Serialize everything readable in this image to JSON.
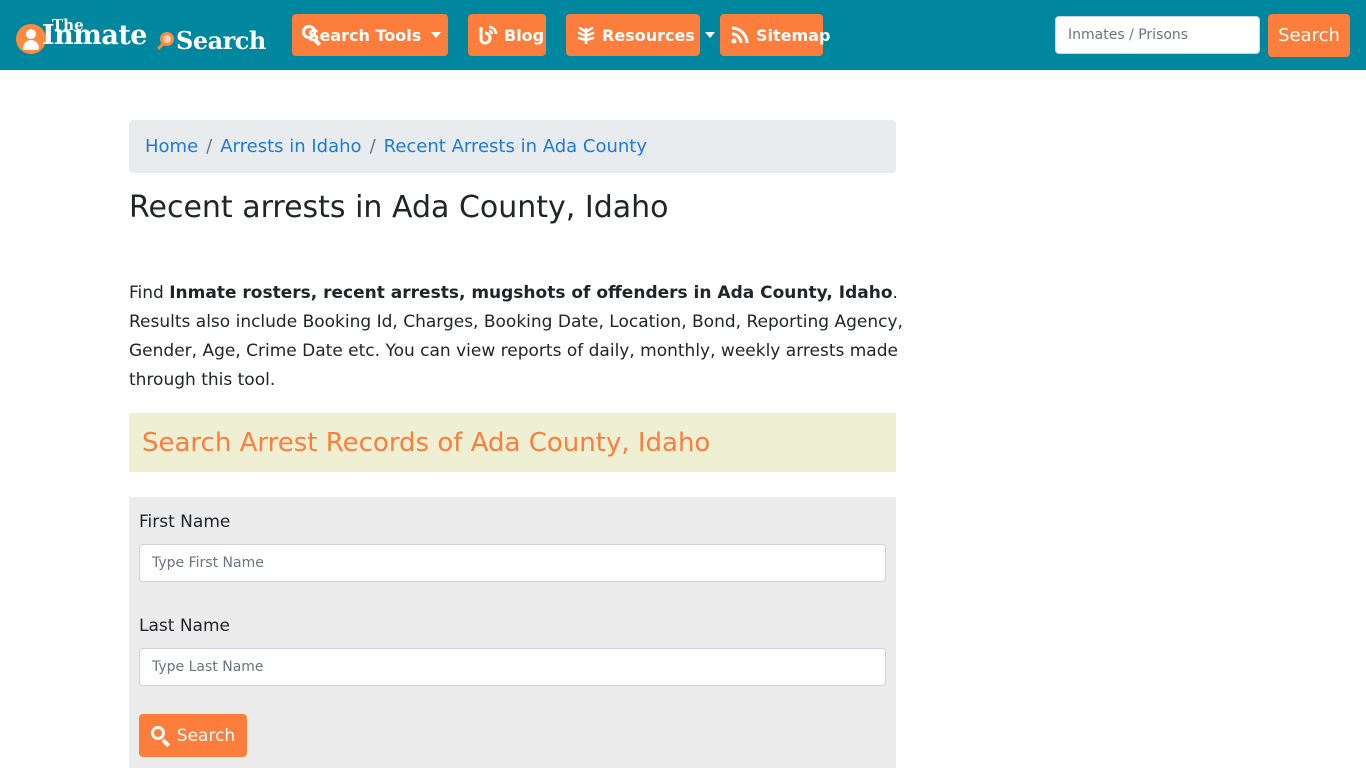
{
  "header": {
    "logo": {
      "the": "The",
      "inmate": "Inmate",
      "search": "Search"
    },
    "nav": [
      {
        "label": "Search Tools",
        "icon": "search-icon",
        "dropdown": true
      },
      {
        "label": "Blog",
        "icon": "blog-icon",
        "dropdown": false
      },
      {
        "label": "Resources",
        "icon": "leaf-icon",
        "dropdown": true
      },
      {
        "label": "Sitemap",
        "icon": "rss-icon",
        "dropdown": false
      }
    ],
    "search": {
      "placeholder": "Inmates / Prisons",
      "value": "",
      "button_label": "Search"
    }
  },
  "breadcrumb": [
    {
      "label": "Home"
    },
    {
      "label": "Arrests in Idaho"
    },
    {
      "label": "Recent Arrests in Ada County"
    }
  ],
  "main": {
    "title": "Recent arrests in Ada County, Idaho",
    "intro": {
      "prefix": "Find ",
      "bold": "Inmate rosters, recent arrests, mugshots of offenders in Ada County, Idaho",
      "suffix": ". Results also include Booking Id, Charges, Booking Date, Location, Bond, Reporting Agency, Gender, Age, Crime Date etc. You can view reports of daily, monthly, weekly arrests made through this tool."
    },
    "section_title": "Search Arrest Records of Ada County, Idaho",
    "form": {
      "first_name_label": "First Name",
      "first_name_placeholder": "Type First Name",
      "first_name_value": "",
      "last_name_label": "Last Name",
      "last_name_placeholder": "Type Last Name",
      "last_name_value": "",
      "submit_label": "Search"
    }
  },
  "colors": {
    "navbar": "#0087a0",
    "accent": "#fd7e3c",
    "link": "#1d7ad6",
    "banner": "#eeefd3",
    "form_panel": "#ececec"
  }
}
